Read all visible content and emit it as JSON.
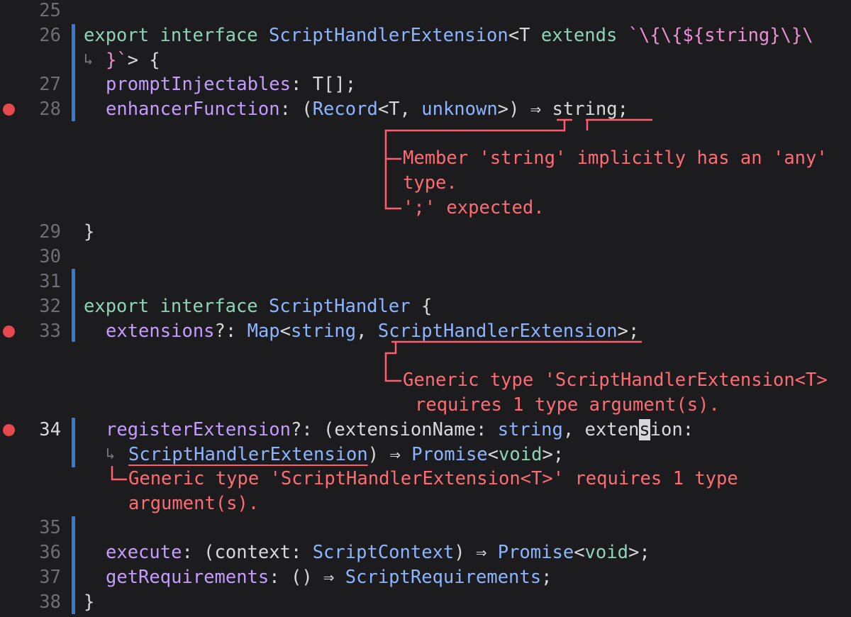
{
  "line_numbers": [
    "25",
    "26",
    "27",
    "28",
    "29",
    "30",
    "31",
    "32",
    "33",
    "34",
    "35",
    "36",
    "37",
    "38"
  ],
  "code": {
    "l26a": {
      "k1": "export",
      "k2": "interface",
      "name": "ScriptHandlerExtension",
      "lt": "<T",
      "k3": "extends",
      "tmpl": "`\\{\\{${string}\\}\\"
    },
    "l26b": {
      "end": "}`",
      "rest": "> {"
    },
    "l27": {
      "prop": "promptInjectables",
      "colon": ":",
      "type": "T[];"
    },
    "l28": {
      "prop": "enhancerFunction",
      "colon": ": (",
      "rec": "Record",
      "lt": "<T, ",
      "unk": "unknown",
      "gt": ">) ",
      "arrow": "⇒",
      "sp": " ",
      "str": "string",
      "semi": ";"
    },
    "l29": "}",
    "l32": {
      "k1": "export",
      "k2": "interface",
      "name": "ScriptHandler",
      "brace": " {"
    },
    "l33": {
      "prop": "extensions",
      "q": "?: ",
      "map": "Map",
      "lt": "<",
      "str": "string",
      "comma": ", ",
      "ext": "ScriptHandlerExtension",
      "end": ">;"
    },
    "l34a": {
      "prop": "registerExtension",
      "q": "?: (extensionName: ",
      "str": "string",
      "c2": ", exten",
      "cur": "s",
      "c3": "ion:"
    },
    "l34b": {
      "ext": "ScriptHandlerExtension",
      "mid": ") ⇒ ",
      "promise": "Promise",
      "lt": "<",
      "void": "void",
      "gt": ">;"
    },
    "l36": {
      "prop": "execute",
      "c1": ": (context: ",
      "ctx": "ScriptContext",
      "c2": ") ⇒ ",
      "promise": "Promise",
      "lt": "<",
      "void": "void",
      "gt": ">;"
    },
    "l37": {
      "prop": "getRequirements",
      "c1": ": () ⇒ ",
      "req": "ScriptRequirements",
      "semi": ";"
    },
    "l38": "}"
  },
  "diagnostics": {
    "d28a_1": "Member 'string' implicitly has an 'any'",
    "d28a_2": "type.",
    "d28b": "';' expected.",
    "d33_1": "Generic type 'ScriptHandlerExtension<T>",
    "d33_2": "requires 1 type argument(s).",
    "d34_1": "Generic type 'ScriptHandlerExtension<T>' requires 1 type",
    "d34_2": "argument(s)."
  },
  "colors": {
    "background": "#1c1c1e",
    "error": "#ff6b73",
    "breakpoint": "#e5484d",
    "diff_bar": "#3a78d4",
    "keyword": "#8fd3b6",
    "type": "#8cb4ff",
    "property": "#c49cff",
    "template_string": "#ea8fd2"
  }
}
